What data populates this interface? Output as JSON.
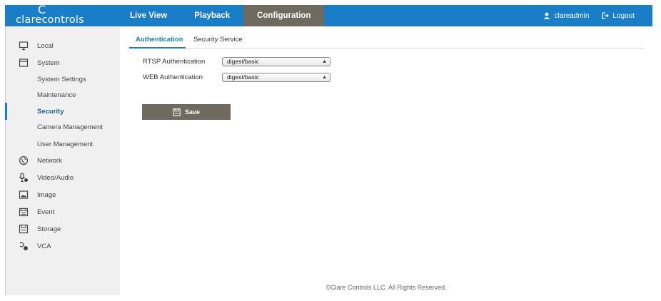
{
  "header": {
    "logo": {
      "mark": "C",
      "wordmark": "clarecontrols"
    },
    "nav": [
      {
        "label": "Live View",
        "active": false
      },
      {
        "label": "Playback",
        "active": false
      },
      {
        "label": "Configuration",
        "active": true
      }
    ],
    "user": {
      "name": "clareadmin",
      "icon": "user-icon"
    },
    "logout": {
      "label": "Logout",
      "icon": "logout-icon"
    }
  },
  "sidebar": {
    "items": [
      {
        "label": "Local",
        "icon": "monitor-icon"
      },
      {
        "label": "System",
        "icon": "window-icon"
      },
      {
        "label": "System Settings"
      },
      {
        "label": "Maintenance"
      },
      {
        "label": "Security",
        "active": true
      },
      {
        "label": "Camera Management"
      },
      {
        "label": "User Management"
      },
      {
        "label": "Network",
        "icon": "globe-icon"
      },
      {
        "label": "Video/Audio",
        "icon": "microphone-icon"
      },
      {
        "label": "Image",
        "icon": "image-icon"
      },
      {
        "label": "Event",
        "icon": "calendar-icon"
      },
      {
        "label": "Storage",
        "icon": "disk-icon"
      },
      {
        "label": "VCA",
        "icon": "vca-icon"
      }
    ]
  },
  "main": {
    "tabs": [
      {
        "label": "Authentication",
        "active": true
      },
      {
        "label": "Security Service",
        "active": false
      }
    ],
    "form": {
      "rtsp": {
        "label": "RTSP Authentication",
        "value": "digest/basic"
      },
      "web": {
        "label": "WEB Authentication",
        "value": "digest/basic"
      }
    },
    "save_label": "Save"
  },
  "footer": {
    "text": "©Clare Controls LLC. All Rights Reserved."
  },
  "colors": {
    "primary": "#1a7dc7",
    "active_tab": "#6f6a5f",
    "sidebar_bg": "#f0f0f0"
  }
}
